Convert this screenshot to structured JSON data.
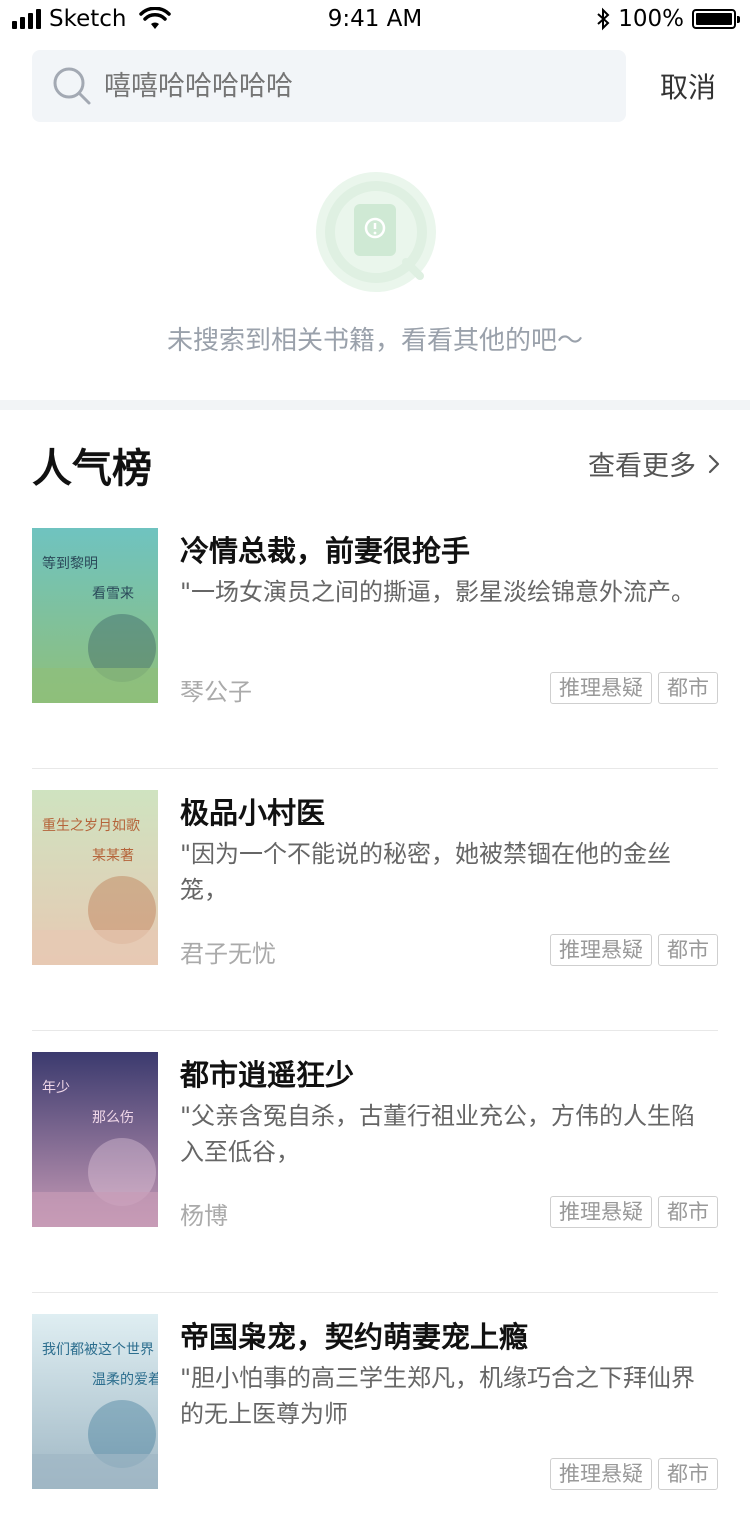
{
  "status_bar": {
    "carrier": "Sketch",
    "time": "9:41 AM",
    "battery": "100%",
    "battery_level": 1.0
  },
  "search": {
    "placeholder": "嘻嘻哈哈哈哈哈",
    "cancel_label": "取消"
  },
  "empty_state": {
    "message": "未搜索到相关书籍，看看其他的吧～"
  },
  "popular": {
    "title": "人气榜",
    "see_more": "查看更多",
    "books": [
      {
        "title": "冷情总裁，前妻很抢手",
        "desc": "\"一场女演员之间的撕逼，影星淡绘锦意外流产。",
        "author": "琴公子",
        "tags": [
          "推理悬疑",
          "都市"
        ],
        "cover_text": [
          "等到黎明",
          "看雪来"
        ],
        "colors": {
          "top": "#6fc3c0",
          "bottom": "#8fbf7a",
          "accent": "#2b4a5a"
        }
      },
      {
        "title": "极品小村医",
        "desc": "\"因为一个不能说的秘密，她被禁锢在他的金丝笼，",
        "author": "君子无忧",
        "tags": [
          "推理悬疑",
          "都市"
        ],
        "cover_text": [
          "重生之岁月如歌",
          "某某著"
        ],
        "colors": {
          "top": "#cfe3c0",
          "bottom": "#e7c9b3",
          "accent": "#b5643a"
        }
      },
      {
        "title": "都市逍遥狂少",
        "desc": "\"父亲含冤自杀，古董行祖业充公，方伟的人生陷入至低谷，",
        "author": "杨博",
        "tags": [
          "推理悬疑",
          "都市"
        ],
        "cover_text": [
          "年少",
          "那么伤"
        ],
        "colors": {
          "top": "#3b3a6e",
          "bottom": "#c79bb6",
          "accent": "#f0d7e8"
        }
      },
      {
        "title": "帝国枭宠，契约萌妻宠上瘾",
        "desc": "\"胆小怕事的高三学生郑凡，机缘巧合之下拜仙界的无上医尊为师",
        "author": "",
        "tags": [
          "推理悬疑",
          "都市"
        ],
        "cover_text": [
          "我们都被这个世界",
          "温柔的爱着"
        ],
        "colors": {
          "top": "#dfeef2",
          "bottom": "#9fb7c4",
          "accent": "#2c6e8e"
        }
      }
    ]
  }
}
